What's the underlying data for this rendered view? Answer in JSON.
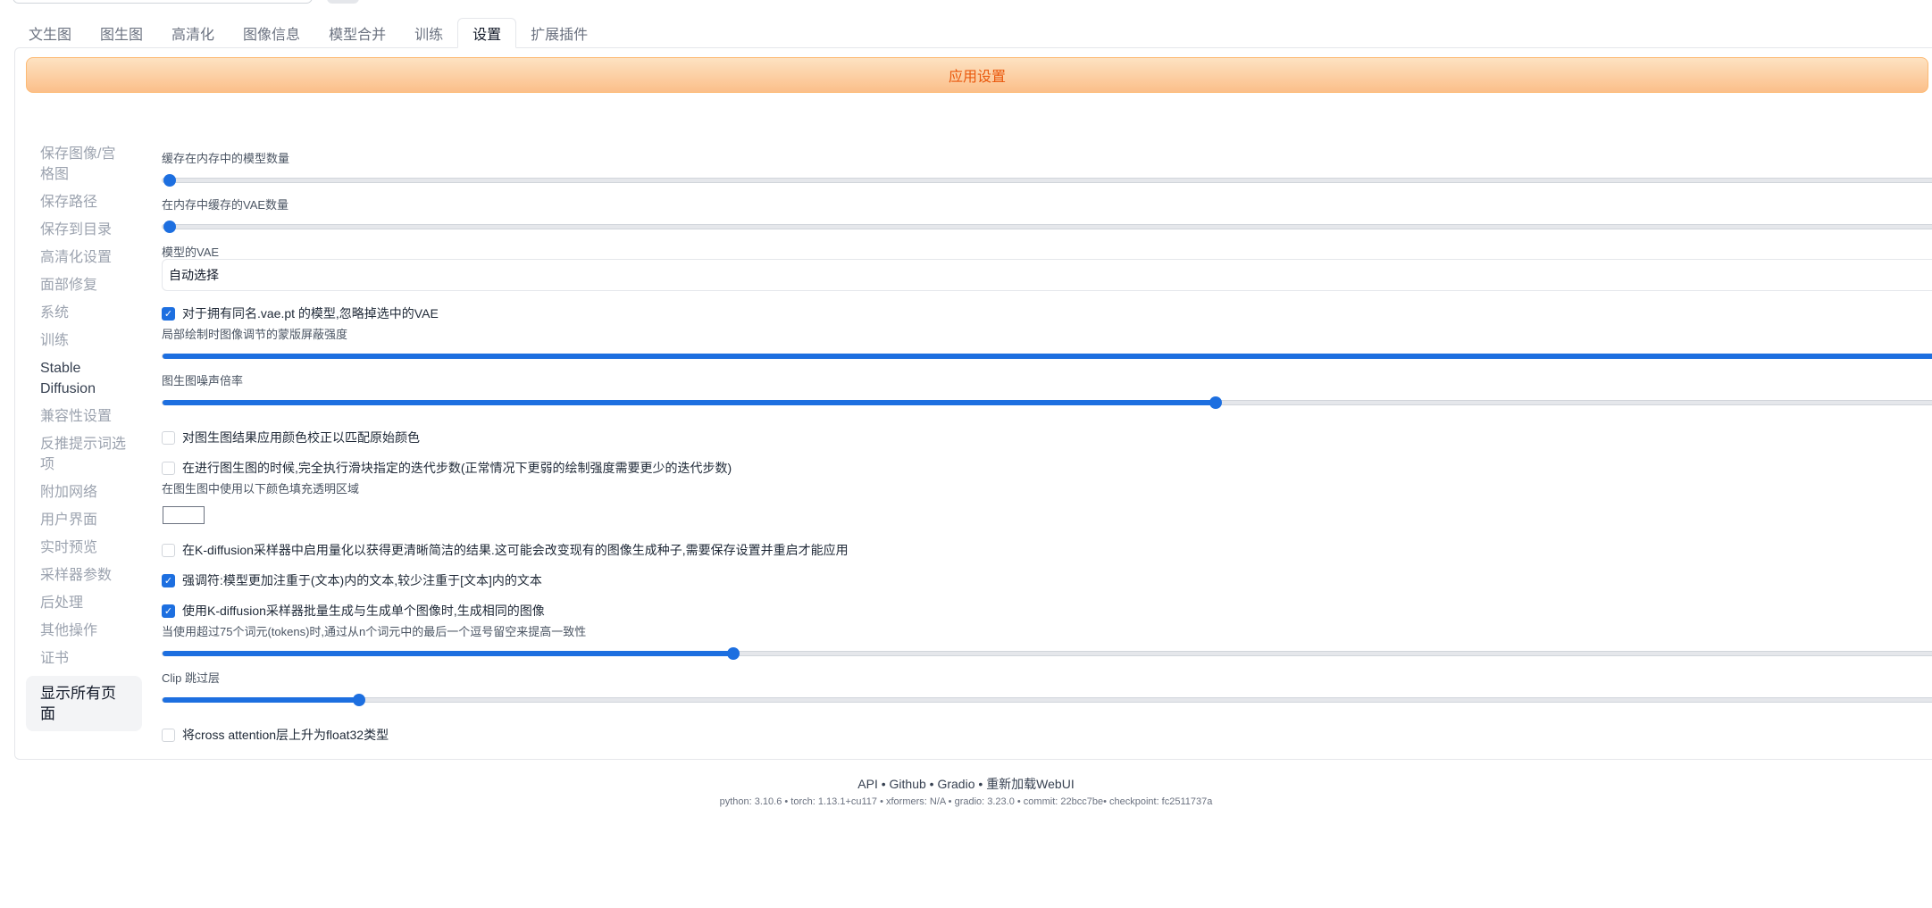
{
  "tabs": [
    "文生图",
    "图生图",
    "高清化",
    "图像信息",
    "模型合并",
    "训练",
    "设置",
    "扩展插件"
  ],
  "active_tab": "设置",
  "apply_label": "应用设置",
  "sidebar": {
    "items": [
      "保存图像/宫格图",
      "保存路径",
      "保存到目录",
      "高清化设置",
      "面部修复",
      "系统",
      "训练",
      "Stable Diffusion",
      "兼容性设置",
      "反推提示词选项",
      "附加网络",
      "用户界面",
      "实时预览",
      "采样器参数",
      "后处理",
      "其他操作",
      "证书"
    ],
    "show_all": "显示所有页面"
  },
  "settings": {
    "model_cache_label": "缓存在内存中的模型数量",
    "model_cache_value": 0,
    "vae_cache_label": "在内存中缓存的VAE数量",
    "vae_cache_value": 0,
    "vae_label": "模型的VAE",
    "vae_value": "自动选择",
    "ignore_vae_label": "对于拥有同名.vae.pt 的模型,忽略掉选中的VAE",
    "ignore_vae_checked": true,
    "inpaint_mask_label": "局部绘制时图像调节的蒙版屏蔽强度",
    "inpaint_mask_value": 1.0,
    "noise_mult_label": "图生图噪声倍率",
    "noise_mult_fraction": 0.59,
    "color_correction_label": "对图生图结果应用颜色校正以匹配原始颜色",
    "color_correction_checked": false,
    "exact_steps_label": "在进行图生图的时候,完全执行滑块指定的迭代步数(正常情况下更弱的绘制强度需要更少的迭代步数)",
    "exact_steps_checked": false,
    "fill_color_label": "在图生图中使用以下颜色填充透明区域",
    "fill_color": "#ffffff",
    "quantize_label": "在K-diffusion采样器中启用量化以获得更清晰简洁的结果.这可能会改变现有的图像生成种子,需要保存设置并重启才能应用",
    "quantize_checked": false,
    "emphasis_label": "强调符:模型更加注重于(文本)内的文本,较少注重于[文本]内的文本",
    "emphasis_checked": true,
    "batch_cond_label": "使用K-diffusion采样器批量生成与生成单个图像时,生成相同的图像",
    "batch_cond_checked": true,
    "comma_padding_label": "当使用超过75个词元(tokens)时,通过从n个词元中的最后一个逗号留空来提高一致性",
    "comma_padding_fraction": 0.32,
    "clip_skip_label": "Clip 跳过层",
    "clip_skip_fraction": 0.11,
    "upcast_attn_label": "将cross attention层上升为float32类型",
    "upcast_attn_checked": false
  },
  "footer": {
    "links": [
      "API",
      "Github",
      "Gradio",
      "重新加载WebUI"
    ],
    "sep": " • ",
    "versions": "python: 3.10.6  •  torch: 1.13.1+cu117  •  xformers: N/A  •  gradio: 3.23.0  •  commit: 22bcc7be•  checkpoint: fc2511737a"
  },
  "colors": {
    "accent": "#1d6fe0",
    "apply_text": "#ea580c",
    "apply_bg": "#fde2c2"
  }
}
